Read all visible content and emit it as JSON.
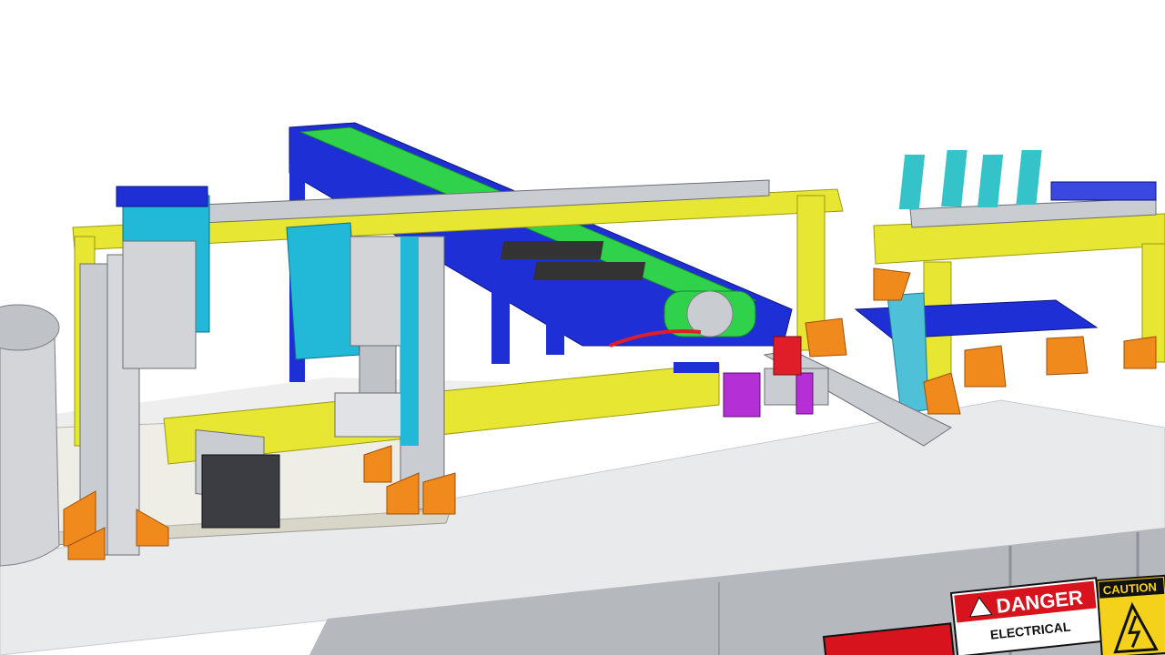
{
  "scene": {
    "description_visible_text_only": true,
    "colors": {
      "frame_yellow": "#e6e633",
      "frame_yellow_dark": "#b9b91c",
      "conveyor_blue": "#1f2fd6",
      "belt_green": "#2fd24a",
      "accent_cyan": "#22b8d8",
      "bracket_orange": "#f08a1c",
      "aluminum": "#c9ccd1",
      "aluminum_dark": "#8d9096",
      "table_top": "#e9eaec",
      "cabinet_gray": "#b5b8bd",
      "purple": "#b52fd6",
      "red": "#e01e2a",
      "danger_red": "#d7141e",
      "caution_yellow": "#f4d21c"
    },
    "signs": {
      "danger_label": "DANGER",
      "electrical_label": "ELECTRICAL",
      "caution_label": "CAUTION"
    }
  }
}
